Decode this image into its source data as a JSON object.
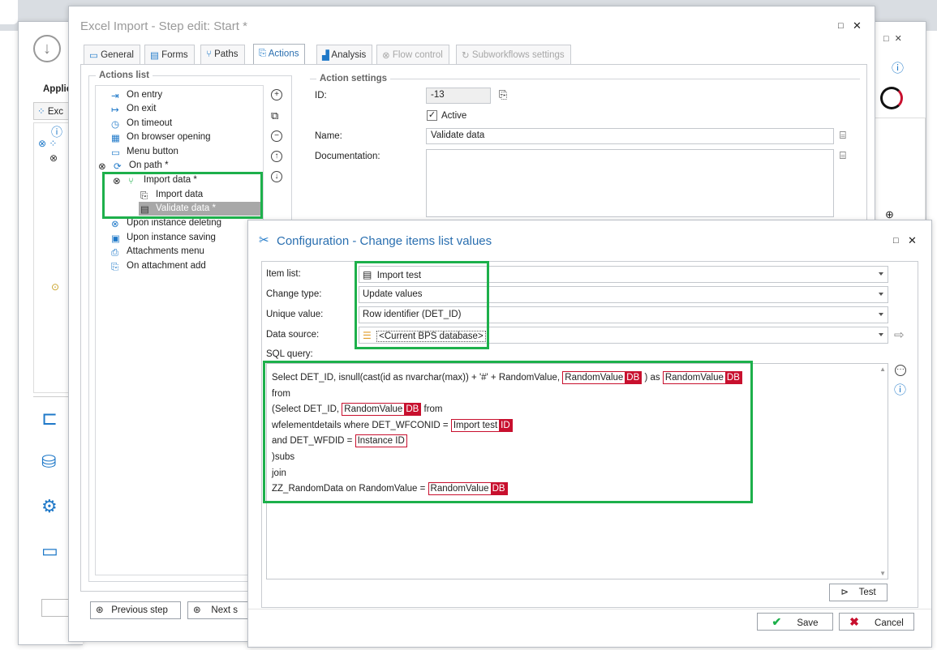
{
  "background_app": {
    "left_label": "Applic",
    "left_tab": "Exc",
    "partial_button": "Next s"
  },
  "step_window": {
    "title": "Excel Import - Step edit: Start *",
    "tabs": [
      {
        "label": "General",
        "icon": "general-icon"
      },
      {
        "label": "Forms",
        "icon": "forms-icon"
      },
      {
        "label": "Paths",
        "icon": "paths-icon"
      },
      {
        "label": "Actions",
        "icon": "actions-icon"
      },
      {
        "label": "Analysis",
        "icon": "analysis-icon"
      },
      {
        "label": "Flow control",
        "icon": "flow-control-icon"
      },
      {
        "label": "Subworkflows settings",
        "icon": "subworkflows-icon"
      }
    ],
    "actions_list_title": "Actions list",
    "tree": [
      {
        "label": "On entry",
        "icon": "on-entry-icon"
      },
      {
        "label": "On exit",
        "icon": "on-exit-icon"
      },
      {
        "label": "On timeout",
        "icon": "clock-icon"
      },
      {
        "label": "On browser opening",
        "icon": "browser-icon"
      },
      {
        "label": "Menu button",
        "icon": "menu-button-icon"
      },
      {
        "label": "On path *",
        "icon": "path-icon"
      },
      {
        "label": "Import data *",
        "icon": "import-icon"
      },
      {
        "label": "Import data",
        "icon": "document-icon"
      },
      {
        "label": "Validate data *",
        "icon": "table-icon"
      },
      {
        "label": "Upon instance deleting",
        "icon": "delete-icon"
      },
      {
        "label": "Upon instance saving",
        "icon": "save-icon"
      },
      {
        "label": "Attachments menu",
        "icon": "attachment-icon"
      },
      {
        "label": "On attachment add",
        "icon": "attachment-add-icon"
      }
    ],
    "action_settings_title": "Action settings",
    "id_label": "ID:",
    "id_value": "-13",
    "active_label": "Active",
    "active_checked": true,
    "name_label": "Name:",
    "name_value": "Validate data",
    "documentation_label": "Documentation:",
    "documentation_value": "",
    "previous_step": "Previous step",
    "next_step": "Next s"
  },
  "config_window": {
    "title": "Configuration - Change items list values",
    "item_list_label": "Item list:",
    "item_list_value": "Import test",
    "change_type_label": "Change type:",
    "change_type_value": "Update values",
    "unique_value_label": "Unique value:",
    "unique_value_value": "Row identifier (DET_ID)",
    "data_source_label": "Data source:",
    "data_source_value": "<Current BPS database>",
    "sql_query_label": "SQL query:",
    "sql": {
      "l1a": "Select DET_ID, isnull(cast(id as  nvarchar(max)) + '#' + RandomValue,",
      "l1t1": "RandomValue",
      "l1b1": "DB",
      "l1c": ")  as",
      "l1t2": "RandomValue",
      "l1b2": "DB",
      "l2": "from",
      "l3a": "(Select DET_ID,",
      "l3t": "RandomValue",
      "l3b": "DB",
      "l3c": "from",
      "l4a": "wfelementdetails where DET_WFCONID =",
      "l4t": "Import test",
      "l4b": "ID",
      "l5a": "and DET_WFDID =",
      "l5t": "Instance ID",
      "l6": ")subs",
      "l7": "join",
      "l8a": "ZZ_RandomData on RandomValue =",
      "l8t": "RandomValue",
      "l8b": "DB"
    },
    "test_label": "Test",
    "save_label": "Save",
    "cancel_label": "Cancel"
  },
  "colors": {
    "highlight_green": "#1db04b",
    "tag_red": "#c8102e",
    "accent_blue": "#1e78c8"
  }
}
